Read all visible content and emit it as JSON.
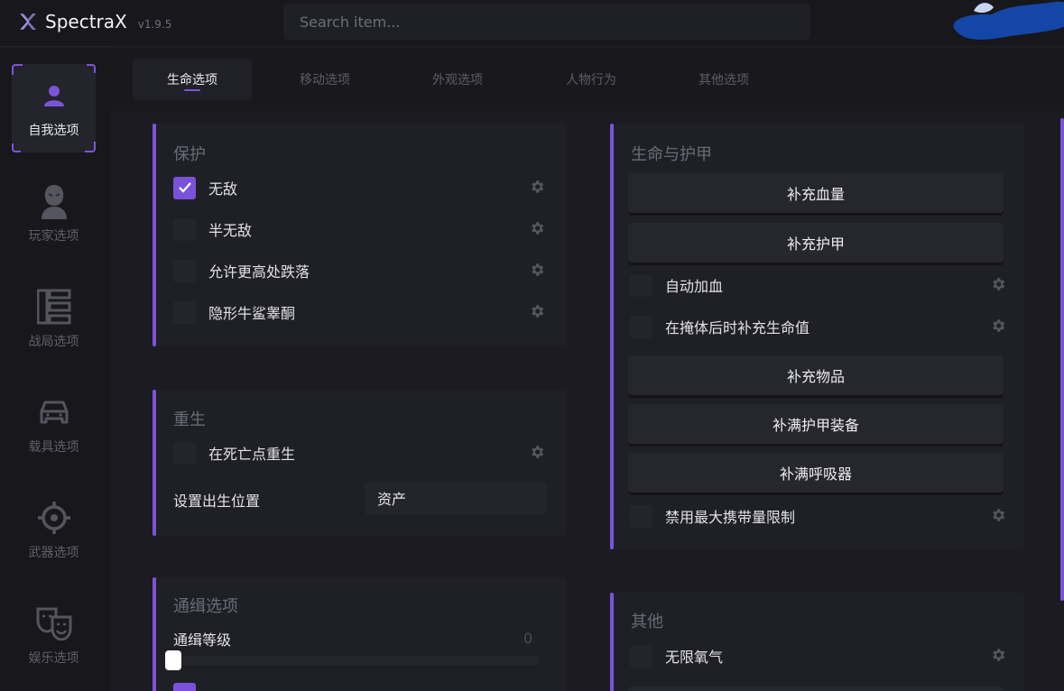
{
  "app": {
    "name": "SpectraX",
    "version": "v1.9.5"
  },
  "search": {
    "placeholder": "Search item..."
  },
  "sidebar": {
    "items": [
      {
        "label": "自我选项",
        "icon": "user-icon",
        "active": true
      },
      {
        "label": "玩家选项",
        "icon": "player-icon",
        "active": false
      },
      {
        "label": "战局选项",
        "icon": "lobby-icon",
        "active": false
      },
      {
        "label": "载具选项",
        "icon": "car-icon",
        "active": false
      },
      {
        "label": "武器选项",
        "icon": "crosshair-icon",
        "active": false
      },
      {
        "label": "娱乐选项",
        "icon": "theater-masks-icon",
        "active": false
      }
    ]
  },
  "tabs": [
    {
      "label": "生命选项",
      "active": true
    },
    {
      "label": "移动选项",
      "active": false
    },
    {
      "label": "外观选项",
      "active": false
    },
    {
      "label": "人物行为",
      "active": false
    },
    {
      "label": "其他选项",
      "active": false
    }
  ],
  "protection": {
    "title": "保护",
    "options": [
      {
        "label": "无敌",
        "checked": true
      },
      {
        "label": "半无敌",
        "checked": false
      },
      {
        "label": "允许更高处跌落",
        "checked": false
      },
      {
        "label": "隐形牛鲨睾酮",
        "checked": false
      }
    ]
  },
  "respawn": {
    "title": "重生",
    "option": {
      "label": "在死亡点重生",
      "checked": false
    },
    "spawn_label": "设置出生位置",
    "spawn_value": "资产"
  },
  "wanted": {
    "title": "通缉选项",
    "level_label": "通缉等级",
    "level_value": "0",
    "level_fraction": 0
  },
  "health_armor": {
    "title": "生命与护甲",
    "buttons": {
      "refill_health": "补充血量",
      "refill_armor": "补充护甲",
      "refill_items": "补充物品",
      "fill_armor_gear": "补满护甲装备",
      "fill_rebreather": "补满呼吸器"
    },
    "options": {
      "auto_heal": {
        "label": "自动加血",
        "checked": false
      },
      "cover_heal": {
        "label": "在掩体后时补充生命值",
        "checked": false
      },
      "disable_carry_limit": {
        "label": "禁用最大携带量限制",
        "checked": false
      }
    }
  },
  "other": {
    "title": "其他",
    "options": [
      {
        "label": "无限氧气",
        "checked": false
      }
    ]
  },
  "colors": {
    "accent": "#7b54d9",
    "background": "#1b1b21",
    "panel": "#1f1f26"
  }
}
